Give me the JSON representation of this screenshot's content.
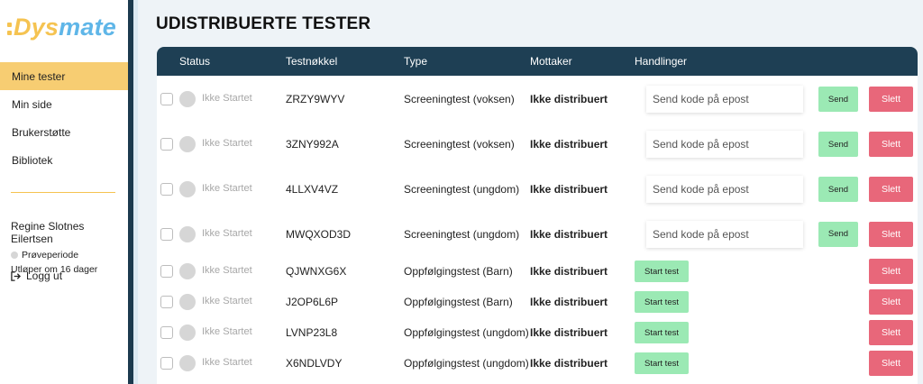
{
  "app": {
    "logo_dys": "Dys",
    "logo_mate": "mate"
  },
  "sidebar": {
    "items": [
      {
        "label": "Mine tester",
        "active": true
      },
      {
        "label": "Min side",
        "active": false
      },
      {
        "label": "Brukerstøtte",
        "active": false
      },
      {
        "label": "Bibliotek",
        "active": false
      }
    ],
    "user_name": "Regine Slotnes Eilertsen",
    "plan": "Prøveperiode",
    "expires": "Utløper om 16 dager",
    "logout_label": "Logg ut"
  },
  "page": {
    "title": "UDISTRIBUERTE TESTER"
  },
  "table": {
    "headers": {
      "status": "Status",
      "key": "Testnøkkel",
      "type": "Type",
      "recipient": "Mottaker",
      "actions": "Handlinger"
    },
    "email_placeholder": "Send kode på epost",
    "send_label": "Send",
    "start_label": "Start test",
    "delete_label": "Slett",
    "rows": [
      {
        "status": "Ikke Startet",
        "key": "ZRZY9WYV",
        "type": "Screeningtest (voksen)",
        "recipient": "Ikke distribuert",
        "action": "email"
      },
      {
        "status": "Ikke Startet",
        "key": "3ZNY992A",
        "type": "Screeningtest (voksen)",
        "recipient": "Ikke distribuert",
        "action": "email"
      },
      {
        "status": "Ikke Startet",
        "key": "4LLXV4VZ",
        "type": "Screeningtest (ungdom)",
        "recipient": "Ikke distribuert",
        "action": "email"
      },
      {
        "status": "Ikke Startet",
        "key": "MWQXOD3D",
        "type": "Screeningtest (ungdom)",
        "recipient": "Ikke distribuert",
        "action": "email"
      },
      {
        "status": "Ikke Startet",
        "key": "QJWNXG6X",
        "type": "Oppfølgingstest (Barn)",
        "recipient": "Ikke distribuert",
        "action": "start"
      },
      {
        "status": "Ikke Startet",
        "key": "J2OP6L6P",
        "type": "Oppfølgingstest (Barn)",
        "recipient": "Ikke distribuert",
        "action": "start"
      },
      {
        "status": "Ikke Startet",
        "key": "LVNP23L8",
        "type": "Oppfølgingstest (ungdom)",
        "recipient": "Ikke distribuert",
        "action": "start"
      },
      {
        "status": "Ikke Startet",
        "key": "X6NDLVDY",
        "type": "Oppfølgingstest (ungdom)",
        "recipient": "Ikke distribuert",
        "action": "start"
      }
    ]
  },
  "colors": {
    "accent_yellow": "#f7cd72",
    "brand_blue": "#5fb6e8",
    "header_dark": "#1e3f54",
    "send_green": "#9be9b4",
    "delete_red": "#e8677a"
  }
}
